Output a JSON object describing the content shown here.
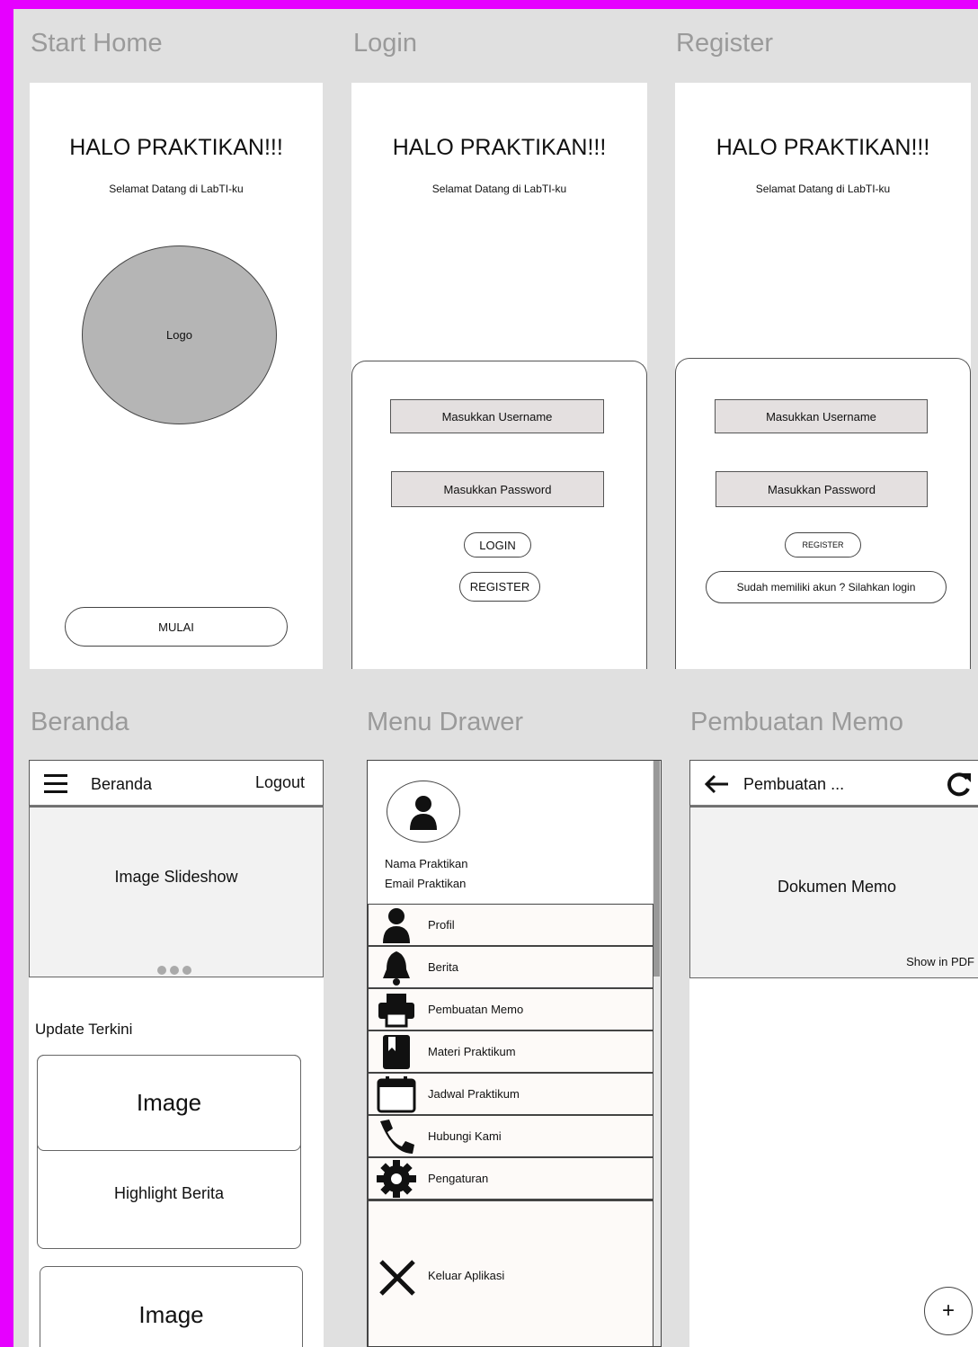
{
  "sections": {
    "start_home": "Start Home",
    "login": "Login",
    "register": "Register",
    "beranda": "Beranda",
    "menu_drawer": "Menu Drawer",
    "pembuatan_memo": "Pembuatan Memo"
  },
  "greeting": {
    "title": "HALO PRAKTIKAN!!!",
    "subtitle": "Selamat Datang di LabTI-ku"
  },
  "start_home": {
    "logo": "Logo",
    "start_button": "MULAI"
  },
  "login": {
    "username_placeholder": "Masukkan Username",
    "password_placeholder": "Masukkan Password",
    "login_button": "LOGIN",
    "register_button": "REGISTER"
  },
  "register": {
    "username_placeholder": "Masukkan Username",
    "password_placeholder": "Masukkan Password",
    "register_button": "REGISTER",
    "login_link": "Sudah memiliki akun ? Silahkan login"
  },
  "beranda": {
    "title": "Beranda",
    "logout": "Logout",
    "slideshow": "Image Slideshow",
    "update_heading": "Update Terkini",
    "card1_image": "Image",
    "card1_text": "Highlight Berita",
    "card2_image": "Image"
  },
  "drawer": {
    "name": "Nama Praktikan",
    "email": "Email Praktikan",
    "items": [
      {
        "label": "Profil",
        "icon": "user-icon"
      },
      {
        "label": "Berita",
        "icon": "bell-icon"
      },
      {
        "label": "Pembuatan Memo",
        "icon": "printer-icon"
      },
      {
        "label": "Materi Praktikum",
        "icon": "book-icon"
      },
      {
        "label": "Jadwal Praktikum",
        "icon": "calendar-icon"
      },
      {
        "label": "Hubungi Kami",
        "icon": "phone-icon"
      },
      {
        "label": "Pengaturan",
        "icon": "gear-icon"
      }
    ],
    "exit": "Keluar Aplikasi"
  },
  "memo": {
    "title": "Pembuatan ...",
    "document": "Dokumen Memo",
    "show_pdf": "Show in PDF",
    "fab": "+"
  }
}
